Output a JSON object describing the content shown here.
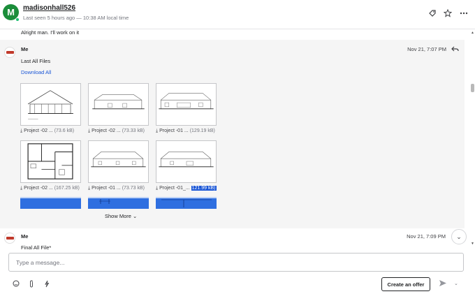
{
  "header": {
    "avatar_letter": "M",
    "username": "madisonhall526",
    "last_seen": "Last seen 5 hours ago — 10:38 AM local time",
    "icons": [
      "label-icon",
      "star-icon",
      "more-icon"
    ]
  },
  "thread": {
    "previous_message": "Alright man. I'll work on it",
    "message1": {
      "sender": "Me",
      "time": "Nov 21, 7:07 PM",
      "text": "Last All Files",
      "download_all": "Download All",
      "files": [
        {
          "name": "Project -02 ...",
          "size": "(73.6 kB)"
        },
        {
          "name": "Project -02 ...",
          "size": "(73.33 kB)"
        },
        {
          "name": "Project -01 ...",
          "size": "(129.19 kB)"
        },
        {
          "name": "Project -02 ...",
          "size": "(167.25 kB)"
        },
        {
          "name": "Project -01 ...",
          "size": "(73.73 kB)"
        },
        {
          "name": "Project -01_...",
          "size": "121.99 kB)"
        }
      ],
      "show_more": "Show More"
    },
    "message2": {
      "sender": "Me",
      "time": "Nov 21, 7:09 PM",
      "text": "Final All File*"
    }
  },
  "composer": {
    "placeholder": "Type a message...",
    "create_offer": "Create an offer"
  },
  "colors": {
    "accent_green": "#1b8d3a",
    "online_dot": "#1dbf73",
    "link_blue": "#1a56d6"
  }
}
